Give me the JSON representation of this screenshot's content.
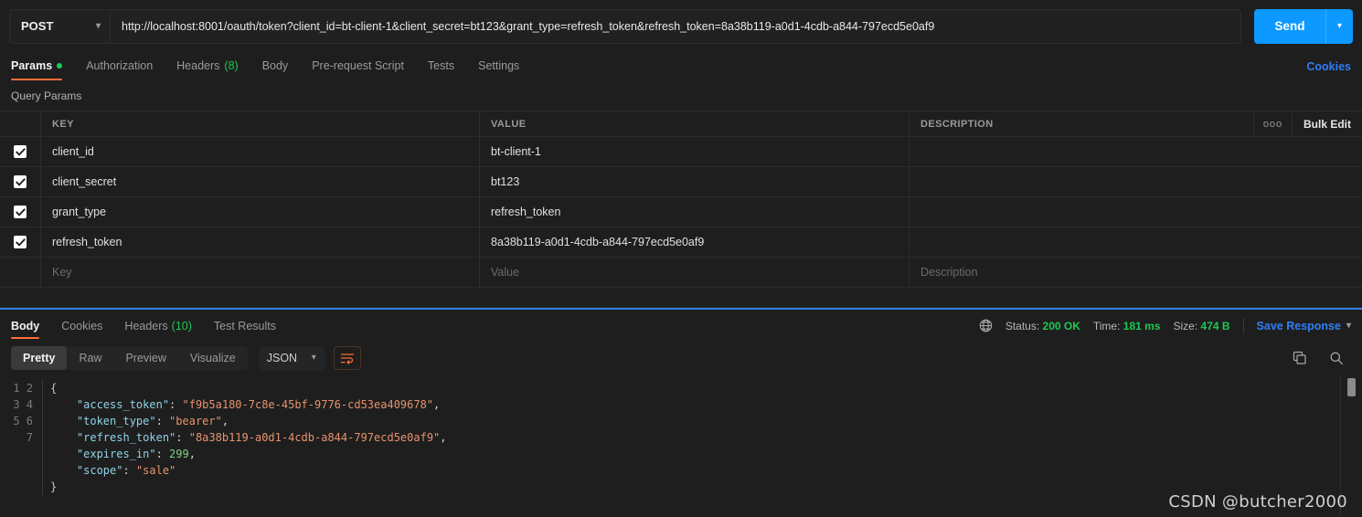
{
  "request": {
    "method": "POST",
    "url": "http://localhost:8001/oauth/token?client_id=bt-client-1&client_secret=bt123&grant_type=refresh_token&refresh_token=8a38b119-a0d1-4cdb-a844-797ecd5e0af9",
    "send_label": "Send",
    "tabs": [
      {
        "label": "Params",
        "badge": "",
        "dot": true,
        "active": true
      },
      {
        "label": "Authorization",
        "badge": "",
        "dot": false,
        "active": false
      },
      {
        "label": "Headers",
        "badge": "(8)",
        "dot": false,
        "active": false
      },
      {
        "label": "Body",
        "badge": "",
        "dot": false,
        "active": false
      },
      {
        "label": "Pre-request Script",
        "badge": "",
        "dot": false,
        "active": false
      },
      {
        "label": "Tests",
        "badge": "",
        "dot": false,
        "active": false
      },
      {
        "label": "Settings",
        "badge": "",
        "dot": false,
        "active": false
      }
    ],
    "cookies_link": "Cookies"
  },
  "query_params": {
    "section_label": "Query Params",
    "columns": {
      "key": "KEY",
      "value": "VALUE",
      "description": "DESCRIPTION"
    },
    "more_icon": "ooo",
    "bulk_edit": "Bulk Edit",
    "rows": [
      {
        "checked": true,
        "key": "client_id",
        "value": "bt-client-1",
        "description": ""
      },
      {
        "checked": true,
        "key": "client_secret",
        "value": "bt123",
        "description": ""
      },
      {
        "checked": true,
        "key": "grant_type",
        "value": "refresh_token",
        "description": ""
      },
      {
        "checked": true,
        "key": "refresh_token",
        "value": "8a38b119-a0d1-4cdb-a844-797ecd5e0af9",
        "description": ""
      }
    ],
    "empty_row": {
      "key": "Key",
      "value": "Value",
      "description": "Description"
    }
  },
  "response": {
    "tabs": [
      {
        "label": "Body",
        "badge": "",
        "active": true
      },
      {
        "label": "Cookies",
        "badge": "",
        "active": false
      },
      {
        "label": "Headers",
        "badge": "(10)",
        "active": false
      },
      {
        "label": "Test Results",
        "badge": "",
        "active": false
      }
    ],
    "status_label": "Status:",
    "status_value": "200 OK",
    "time_label": "Time:",
    "time_value": "181 ms",
    "size_label": "Size:",
    "size_value": "474 B",
    "save_response": "Save Response",
    "view_modes": [
      "Pretty",
      "Raw",
      "Preview",
      "Visualize"
    ],
    "active_view": "Pretty",
    "format": "JSON",
    "line_numbers": [
      "1",
      "2",
      "3",
      "4",
      "5",
      "6",
      "7"
    ],
    "json": {
      "access_token": "f9b5a180-7c8e-45bf-9776-cd53ea409678",
      "token_type": "bearer",
      "refresh_token": "8a38b119-a0d1-4cdb-a844-797ecd5e0af9",
      "expires_in": 299,
      "scope": "sale"
    }
  },
  "watermark": "CSDN @butcher2000",
  "colors": {
    "accent_orange": "#ff6c37",
    "link_blue": "#2f7ef6",
    "send_blue": "#0d99ff",
    "success_green": "#1ec853",
    "background": "#1e1e1e",
    "border": "#2c2c2c"
  }
}
